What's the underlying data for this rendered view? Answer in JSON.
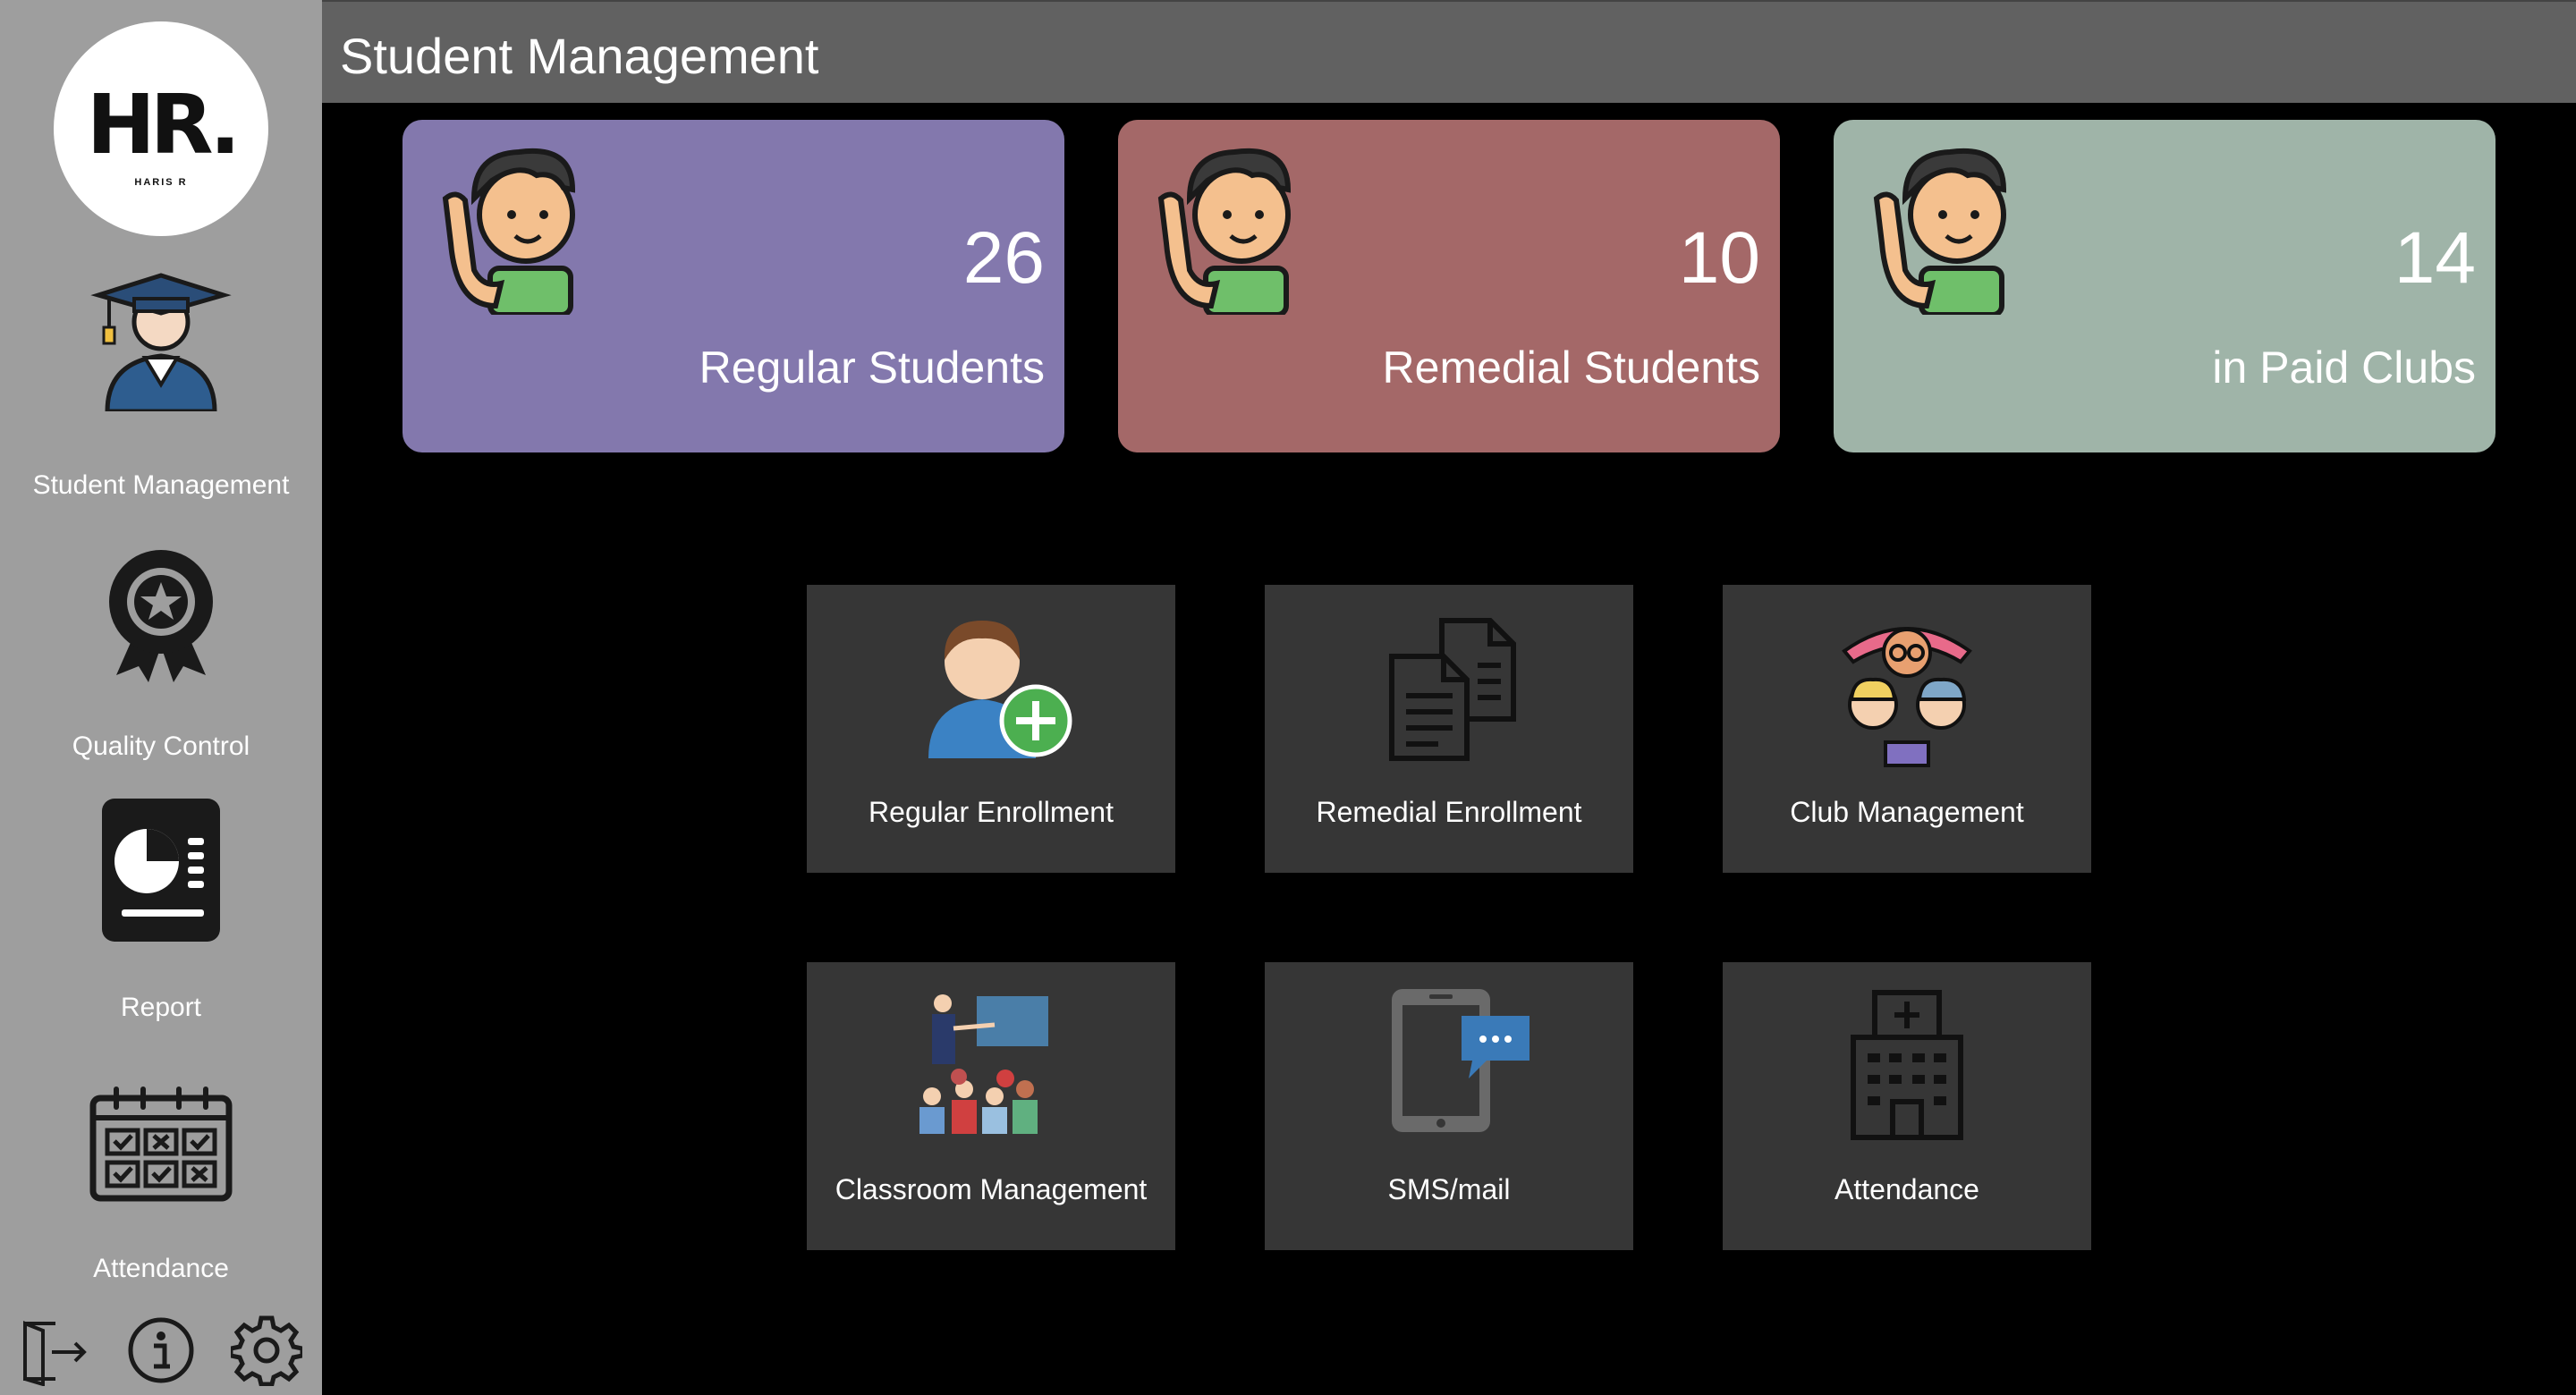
{
  "app": {
    "logo_text": "HR.",
    "logo_subtext": "HARIS R"
  },
  "sidebar": {
    "items": [
      {
        "label": "Student Management",
        "icon": "graduate-icon"
      },
      {
        "label": "Quality Control",
        "icon": "award-badge-icon"
      },
      {
        "label": "Report",
        "icon": "report-chart-icon"
      },
      {
        "label": "Attendance",
        "icon": "calendar-icon"
      }
    ],
    "bottom_icons": [
      "logout-door-icon",
      "info-icon",
      "gear-icon"
    ]
  },
  "header": {
    "title": "Student Management"
  },
  "stats": [
    {
      "count": "26",
      "caption": "Regular Students",
      "color": "#8378ad"
    },
    {
      "count": "10",
      "caption": "Remedial Students",
      "color": "#a46868"
    },
    {
      "count": "14",
      "caption": "in Paid Clubs",
      "color": "#9fb4a8"
    }
  ],
  "tiles": [
    {
      "label": "Regular Enrollment",
      "icon": "add-user-icon"
    },
    {
      "label": "Remedial Enrollment",
      "icon": "documents-icon"
    },
    {
      "label": "Club Management",
      "icon": "group-icon"
    },
    {
      "label": "Classroom Management",
      "icon": "classroom-icon"
    },
    {
      "label": "SMS/mail",
      "icon": "phone-message-icon"
    },
    {
      "label": "Attendance",
      "icon": "building-icon"
    }
  ]
}
